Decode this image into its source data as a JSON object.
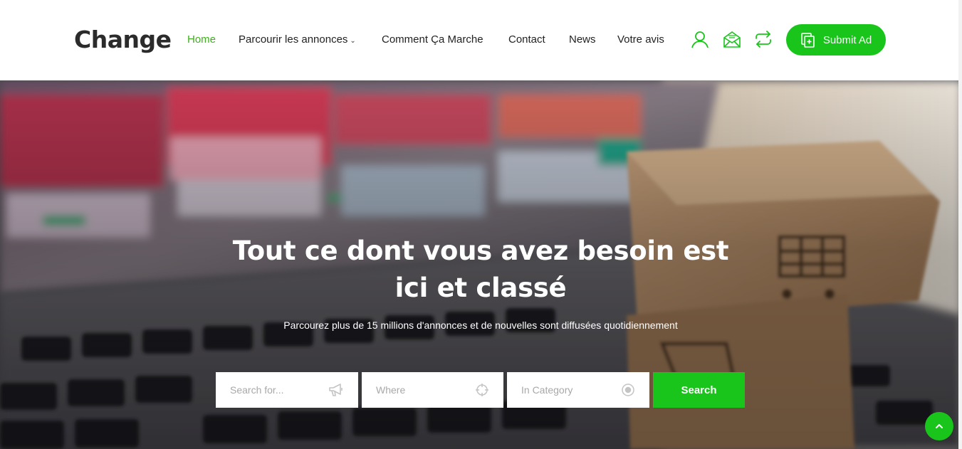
{
  "brand": {
    "name": "Change"
  },
  "nav": {
    "items": [
      {
        "label": "Home",
        "active": true
      },
      {
        "label": "Parcourir les annonces",
        "has_dropdown": true
      },
      {
        "label": "Comment Ça Marche"
      },
      {
        "label": "Contact"
      },
      {
        "label": "News"
      },
      {
        "label": "Votre avis"
      }
    ],
    "dropdown_caret": "⌄"
  },
  "header_icons": [
    "user-icon",
    "envelope-icon",
    "exchange-icon"
  ],
  "submit_button": {
    "label": "Submit Ad",
    "icon": "add-document-icon"
  },
  "hero": {
    "title": "Tout ce dont vous avez besoin est ici et classé",
    "subtitle": "Parcourez plus de 15 millions d'annonces et de nouvelles sont diffusées quotidiennement"
  },
  "search": {
    "query_placeholder": "Search for...",
    "query_icon": "megaphone-icon",
    "where_placeholder": "Where",
    "where_icon": "crosshair-icon",
    "category_placeholder": "In Category",
    "category_icon": "radio-target-icon",
    "button_label": "Search"
  },
  "colors": {
    "accent": "#19c51b",
    "nav_active": "#3fb11d",
    "text": "#222222"
  }
}
